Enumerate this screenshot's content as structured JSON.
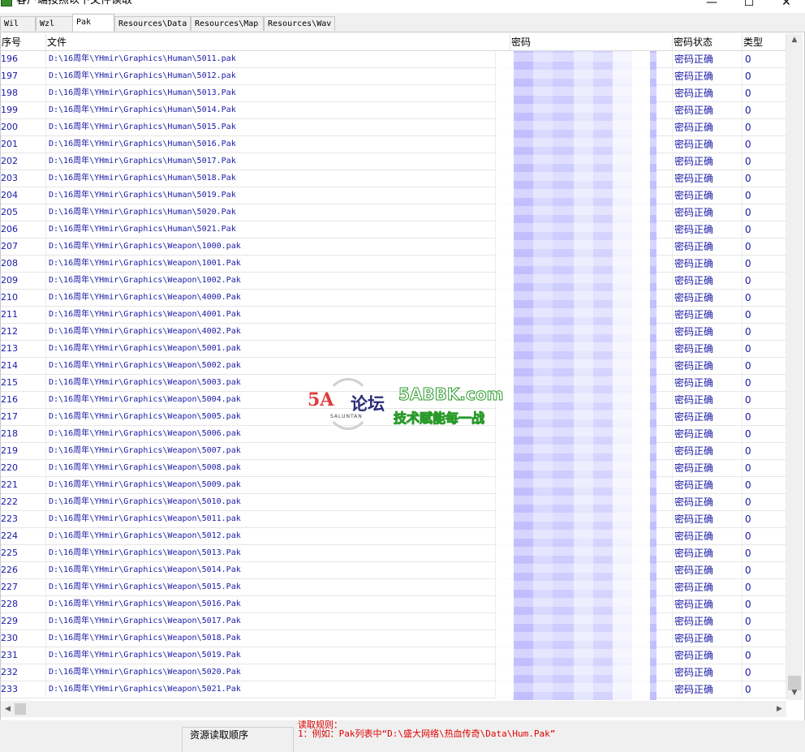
{
  "window": {
    "title": "客户端按照以下文件读取"
  },
  "tabs": [
    {
      "label": "Wil"
    },
    {
      "label": "Wzl"
    },
    {
      "label": "Pak"
    },
    {
      "label": "Resources\\Data"
    },
    {
      "label": "Resources\\Map"
    },
    {
      "label": "Resources\\Wav"
    }
  ],
  "columns": {
    "num": "序号",
    "file": "文件",
    "password": "密码",
    "status": "密码状态",
    "type": "类型"
  },
  "rows": [
    {
      "num": "196",
      "file": "D:\\16周年\\YHmir\\Graphics\\Human\\5011.pak",
      "status": "密码正确",
      "type": "0"
    },
    {
      "num": "197",
      "file": "D:\\16周年\\YHmir\\Graphics\\Human\\5012.pak",
      "status": "密码正确",
      "type": "0"
    },
    {
      "num": "198",
      "file": "D:\\16周年\\YHmir\\Graphics\\Human\\5013.Pak",
      "status": "密码正确",
      "type": "0"
    },
    {
      "num": "199",
      "file": "D:\\16周年\\YHmir\\Graphics\\Human\\5014.Pak",
      "status": "密码正确",
      "type": "0"
    },
    {
      "num": "200",
      "file": "D:\\16周年\\YHmir\\Graphics\\Human\\5015.Pak",
      "status": "密码正确",
      "type": "0"
    },
    {
      "num": "201",
      "file": "D:\\16周年\\YHmir\\Graphics\\Human\\5016.Pak",
      "status": "密码正确",
      "type": "0"
    },
    {
      "num": "202",
      "file": "D:\\16周年\\YHmir\\Graphics\\Human\\5017.Pak",
      "status": "密码正确",
      "type": "0"
    },
    {
      "num": "203",
      "file": "D:\\16周年\\YHmir\\Graphics\\Human\\5018.Pak",
      "status": "密码正确",
      "type": "0"
    },
    {
      "num": "204",
      "file": "D:\\16周年\\YHmir\\Graphics\\Human\\5019.Pak",
      "status": "密码正确",
      "type": "0"
    },
    {
      "num": "205",
      "file": "D:\\16周年\\YHmir\\Graphics\\Human\\5020.Pak",
      "status": "密码正确",
      "type": "0"
    },
    {
      "num": "206",
      "file": "D:\\16周年\\YHmir\\Graphics\\Human\\5021.Pak",
      "status": "密码正确",
      "type": "0"
    },
    {
      "num": "207",
      "file": "D:\\16周年\\YHmir\\Graphics\\Weapon\\1000.pak",
      "status": "密码正确",
      "type": "0"
    },
    {
      "num": "208",
      "file": "D:\\16周年\\YHmir\\Graphics\\Weapon\\1001.Pak",
      "status": "密码正确",
      "type": "0"
    },
    {
      "num": "209",
      "file": "D:\\16周年\\YHmir\\Graphics\\Weapon\\1002.Pak",
      "status": "密码正确",
      "type": "0"
    },
    {
      "num": "210",
      "file": "D:\\16周年\\YHmir\\Graphics\\Weapon\\4000.Pak",
      "status": "密码正确",
      "type": "0"
    },
    {
      "num": "211",
      "file": "D:\\16周年\\YHmir\\Graphics\\Weapon\\4001.Pak",
      "status": "密码正确",
      "type": "0"
    },
    {
      "num": "212",
      "file": "D:\\16周年\\YHmir\\Graphics\\Weapon\\4002.Pak",
      "status": "密码正确",
      "type": "0"
    },
    {
      "num": "213",
      "file": "D:\\16周年\\YHmir\\Graphics\\Weapon\\5001.pak",
      "status": "密码正确",
      "type": "0"
    },
    {
      "num": "214",
      "file": "D:\\16周年\\YHmir\\Graphics\\Weapon\\5002.pak",
      "status": "密码正确",
      "type": "0"
    },
    {
      "num": "215",
      "file": "D:\\16周年\\YHmir\\Graphics\\Weapon\\5003.pak",
      "status": "密码正确",
      "type": "0"
    },
    {
      "num": "216",
      "file": "D:\\16周年\\YHmir\\Graphics\\Weapon\\5004.pak",
      "status": "密码正确",
      "type": "0"
    },
    {
      "num": "217",
      "file": "D:\\16周年\\YHmir\\Graphics\\Weapon\\5005.pak",
      "status": "密码正确",
      "type": "0"
    },
    {
      "num": "218",
      "file": "D:\\16周年\\YHmir\\Graphics\\Weapon\\5006.pak",
      "status": "密码正确",
      "type": "0"
    },
    {
      "num": "219",
      "file": "D:\\16周年\\YHmir\\Graphics\\Weapon\\5007.pak",
      "status": "密码正确",
      "type": "0"
    },
    {
      "num": "220",
      "file": "D:\\16周年\\YHmir\\Graphics\\Weapon\\5008.pak",
      "status": "密码正确",
      "type": "0"
    },
    {
      "num": "221",
      "file": "D:\\16周年\\YHmir\\Graphics\\Weapon\\5009.pak",
      "status": "密码正确",
      "type": "0"
    },
    {
      "num": "222",
      "file": "D:\\16周年\\YHmir\\Graphics\\Weapon\\5010.pak",
      "status": "密码正确",
      "type": "0"
    },
    {
      "num": "223",
      "file": "D:\\16周年\\YHmir\\Graphics\\Weapon\\5011.pak",
      "status": "密码正确",
      "type": "0"
    },
    {
      "num": "224",
      "file": "D:\\16周年\\YHmir\\Graphics\\Weapon\\5012.pak",
      "status": "密码正确",
      "type": "0"
    },
    {
      "num": "225",
      "file": "D:\\16周年\\YHmir\\Graphics\\Weapon\\5013.Pak",
      "status": "密码正确",
      "type": "0"
    },
    {
      "num": "226",
      "file": "D:\\16周年\\YHmir\\Graphics\\Weapon\\5014.Pak",
      "status": "密码正确",
      "type": "0"
    },
    {
      "num": "227",
      "file": "D:\\16周年\\YHmir\\Graphics\\Weapon\\5015.Pak",
      "status": "密码正确",
      "type": "0"
    },
    {
      "num": "228",
      "file": "D:\\16周年\\YHmir\\Graphics\\Weapon\\5016.Pak",
      "status": "密码正确",
      "type": "0"
    },
    {
      "num": "229",
      "file": "D:\\16周年\\YHmir\\Graphics\\Weapon\\5017.Pak",
      "status": "密码正确",
      "type": "0"
    },
    {
      "num": "230",
      "file": "D:\\16周年\\YHmir\\Graphics\\Weapon\\5018.Pak",
      "status": "密码正确",
      "type": "0"
    },
    {
      "num": "231",
      "file": "D:\\16周年\\YHmir\\Graphics\\Weapon\\5019.Pak",
      "status": "密码正确",
      "type": "0"
    },
    {
      "num": "232",
      "file": "D:\\16周年\\YHmir\\Graphics\\Weapon\\5020.Pak",
      "status": "密码正确",
      "type": "0"
    },
    {
      "num": "233",
      "file": "D:\\16周年\\YHmir\\Graphics\\Weapon\\5021.Pak",
      "status": "密码正确",
      "type": "0"
    }
  ],
  "watermark": {
    "logo": "5A",
    "logo_cn": "论坛",
    "sub": "SALUNTAN",
    "domain": "5ABBK.com",
    "slogan": "技术赋能每一战"
  },
  "bottom": {
    "group_label": "资源读取顺序",
    "rules_title": "读取规则：",
    "rules_line1": "1：例如：Pak列表中“D:\\盛大网络\\热血传奇\\Data\\Hum.Pak”"
  },
  "colors": {
    "row_text": "#1a1aa6",
    "rules_text": "#e00000",
    "redacted": "#b7b4ff"
  },
  "icons": {
    "title": "app-icon",
    "minimize": "minimize-icon",
    "maximize": "maximize-icon",
    "close": "close-icon"
  }
}
